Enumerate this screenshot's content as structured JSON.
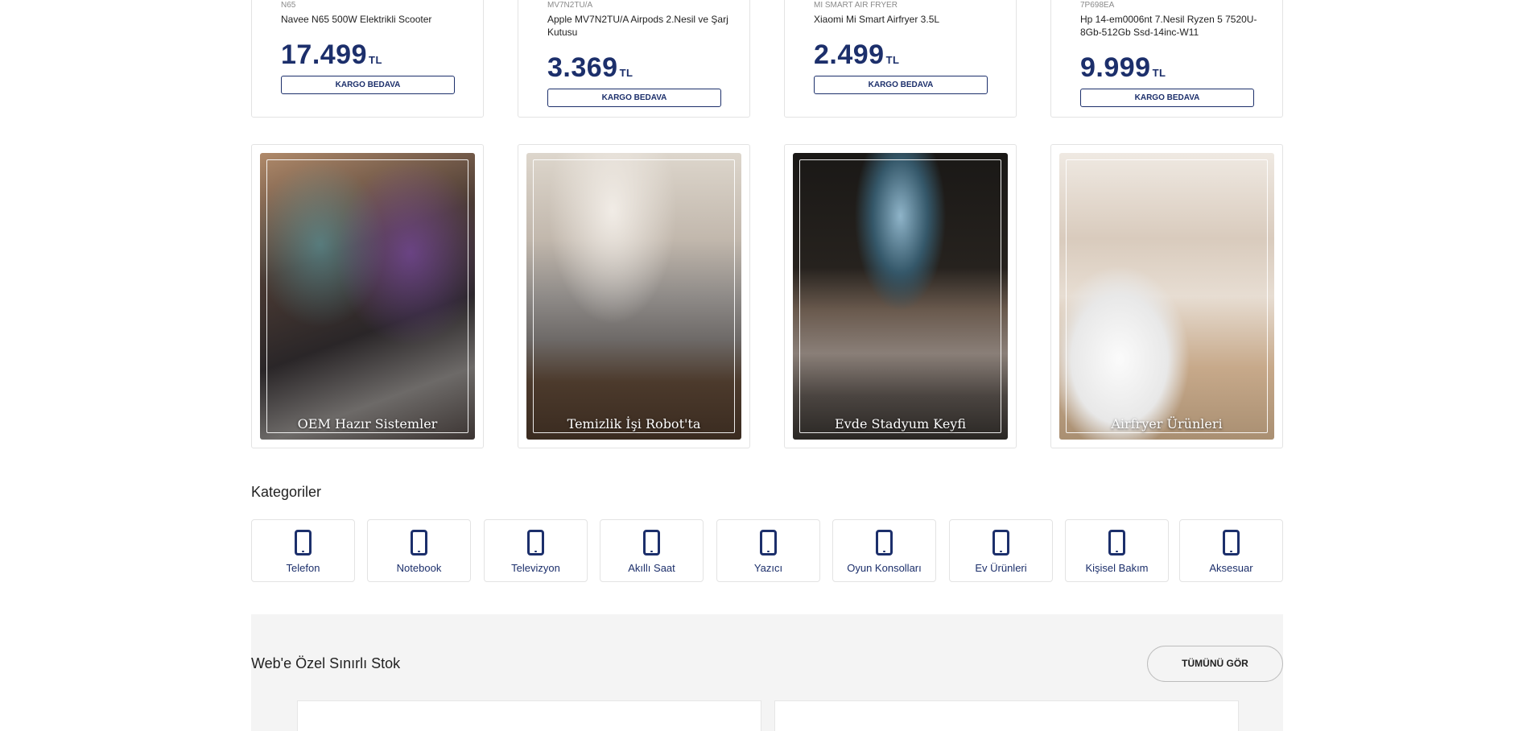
{
  "products": [
    {
      "sku": "N65",
      "name": "Navee N65 500W Elektrikli Scooter",
      "price": "17.499",
      "currency": "TL",
      "cargo": "KARGO BEDAVA"
    },
    {
      "sku": "MV7N2TU/A",
      "name": "Apple MV7N2TU/A Airpods 2.Nesil ve Şarj Kutusu",
      "price": "3.369",
      "currency": "TL",
      "cargo": "KARGO BEDAVA"
    },
    {
      "sku": "Mi SMART AIR FRYER",
      "name": "Xiaomi Mi Smart Airfryer 3.5L",
      "price": "2.499",
      "currency": "TL",
      "cargo": "KARGO BEDAVA"
    },
    {
      "sku": "7P698EA",
      "name": "Hp 14-em0006nt 7.Nesil Ryzen 5 7520U-8Gb-512Gb Ssd-14inc-W11",
      "price": "9.999",
      "currency": "TL",
      "cargo": "KARGO BEDAVA"
    }
  ],
  "banners": [
    {
      "label": "OEM Hazır Sistemler"
    },
    {
      "label": "Temizlik İşi Robot'ta"
    },
    {
      "label": "Evde Stadyum Keyfi"
    },
    {
      "label": "Airfryer Ürünleri"
    }
  ],
  "categories": {
    "title": "Kategoriler",
    "items": [
      {
        "label": "Telefon"
      },
      {
        "label": "Notebook"
      },
      {
        "label": "Televizyon"
      },
      {
        "label": "Akıllı Saat"
      },
      {
        "label": "Yazıcı"
      },
      {
        "label": "Oyun Konsolları"
      },
      {
        "label": "Ev Ürünleri"
      },
      {
        "label": "Kişisel Bakım"
      },
      {
        "label": "Aksesuar"
      }
    ],
    "icon": "phone-icon"
  },
  "web_special": {
    "title": "Web'e Özel Sınırlı Stok",
    "see_all": "TÜMÜNÜ GÖR"
  },
  "colors": {
    "brand_navy": "#1c2f6b",
    "section_bg": "#f4f4f4",
    "border": "#e3e3e3"
  }
}
